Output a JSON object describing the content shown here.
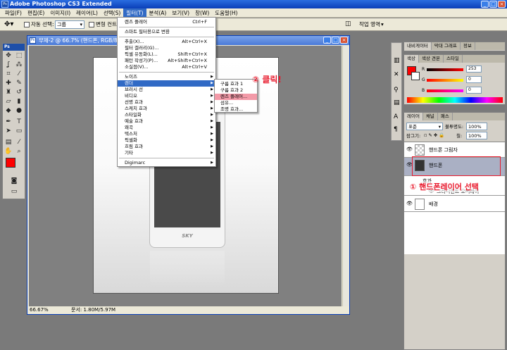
{
  "app": {
    "title": "Adobe Photoshop CS3 Extended"
  },
  "menubar": [
    "파일(F)",
    "편집(E)",
    "이미지(I)",
    "레이어(L)",
    "선택(S)",
    "필터(T)",
    "분석(A)",
    "보기(V)",
    "창(W)",
    "도움말(H)"
  ],
  "options": {
    "auto_select": "자동 선택:",
    "group": "그룹",
    "transform": "변형 컨트",
    "workspace": "작업 영역"
  },
  "document": {
    "title": "무제-2 @ 66.7% (핸드폰, RGB/8)",
    "zoom": "66.67%",
    "doc_size": "문서: 1.80M/5.97M",
    "brand": "SKY"
  },
  "filter_menu": {
    "items": [
      {
        "label": "렌즈 플레어",
        "shortcut": "Ctrl+F"
      },
      {
        "label": "스마트 필터용으로 변환",
        "shortcut": ""
      },
      {
        "label": "추출(X)...",
        "shortcut": "Alt+Ctrl+X"
      },
      {
        "label": "필터 갤러리(G)...",
        "shortcut": ""
      },
      {
        "label": "픽셀 유동화(L)...",
        "shortcut": "Shift+Ctrl+X"
      },
      {
        "label": "패턴 작성기(P)...",
        "shortcut": "Alt+Shift+Ctrl+X"
      },
      {
        "label": "소실점(V)...",
        "shortcut": "Alt+Ctrl+V"
      },
      {
        "label": "노이즈",
        "shortcut": ""
      },
      {
        "label": "렌더",
        "shortcut": ""
      },
      {
        "label": "브러시 선",
        "shortcut": ""
      },
      {
        "label": "비디오",
        "shortcut": ""
      },
      {
        "label": "선명 효과",
        "shortcut": ""
      },
      {
        "label": "스케치 효과",
        "shortcut": ""
      },
      {
        "label": "스타일화",
        "shortcut": ""
      },
      {
        "label": "예술 효과",
        "shortcut": ""
      },
      {
        "label": "왜곡",
        "shortcut": ""
      },
      {
        "label": "텍스처",
        "shortcut": ""
      },
      {
        "label": "픽셀화",
        "shortcut": ""
      },
      {
        "label": "흐림 효과",
        "shortcut": ""
      },
      {
        "label": "기타",
        "shortcut": ""
      },
      {
        "label": "Digimarc",
        "shortcut": ""
      }
    ]
  },
  "render_submenu": [
    "구름 효과 1",
    "구름 효과 2",
    "렌즈 플레어...",
    "섬유...",
    "조명 효과..."
  ],
  "annotations": {
    "step2": "② 클릭!",
    "step1": "① 핸드폰레이어 선택"
  },
  "navigator_tabs": [
    "내비게이터",
    "막대 그래프",
    "정보"
  ],
  "color_tabs": [
    "색상",
    "색상 견본",
    "스타일"
  ],
  "color": {
    "r_label": "R",
    "r_value": "253",
    "g_label": "G",
    "g_value": "0",
    "b_label": "B",
    "b_value": "0",
    "fg": "#fd0000"
  },
  "layers_tabs": [
    "레이어",
    "채널",
    "패스"
  ],
  "layers_panel": {
    "blend": "표준",
    "opacity_label": "불투명도:",
    "opacity": "100%",
    "lock_label": "잠그기:",
    "fill_label": "칠:",
    "fill": "100%"
  },
  "layers": [
    {
      "name": "핸드폰 그림자"
    },
    {
      "name": "핸드폰"
    },
    {
      "name": "효과"
    },
    {
      "name": "그라디언트 오버레이"
    },
    {
      "name": "배경"
    }
  ]
}
